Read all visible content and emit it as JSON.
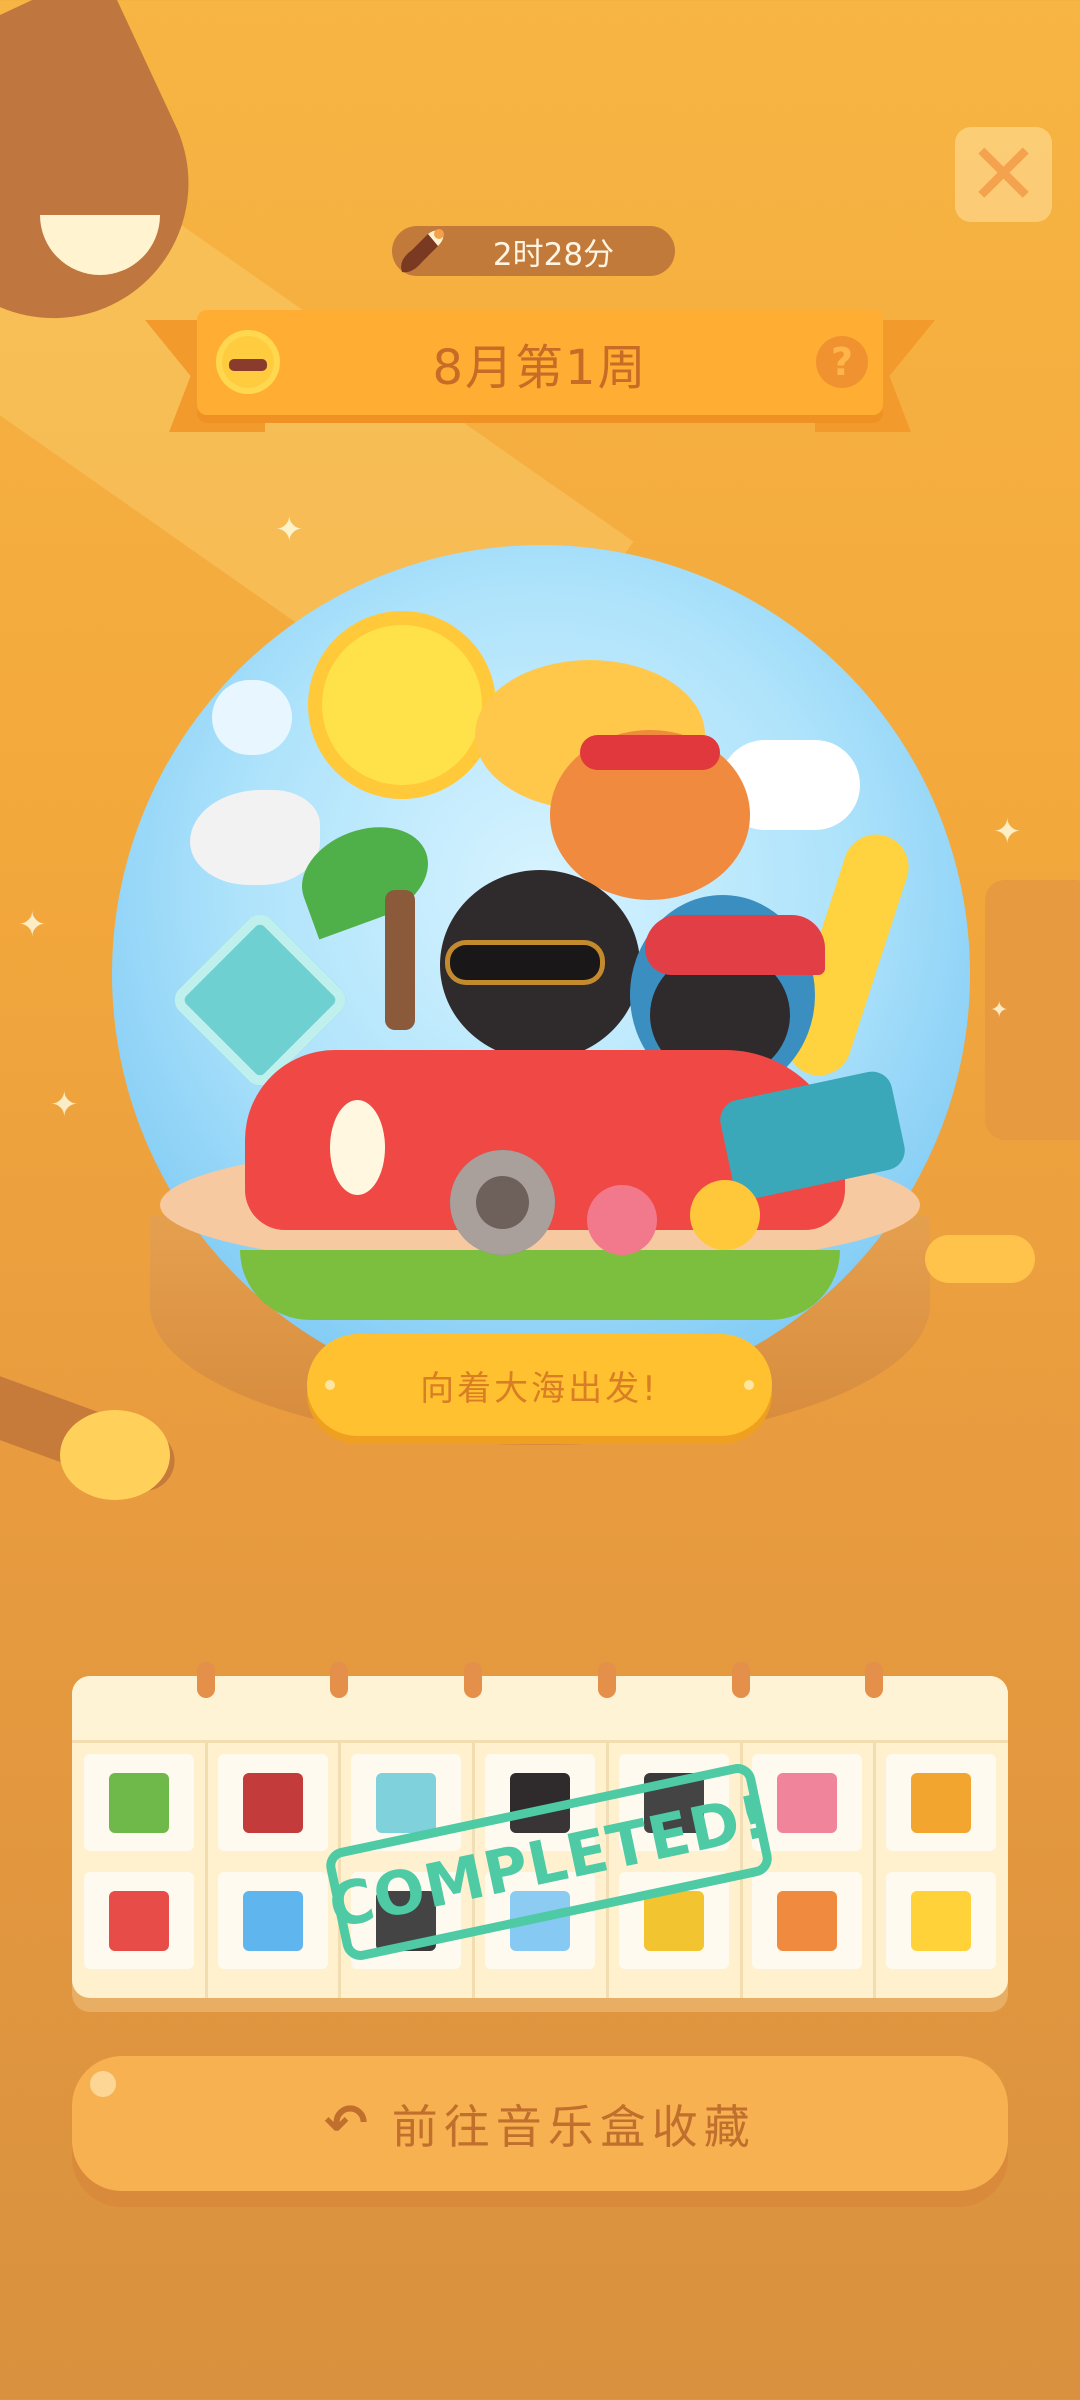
{
  "header": {
    "timer_text": "2时28分",
    "banner_title": "8月第1周",
    "close_icon": "close-icon",
    "help_icon": "help-icon",
    "sun_icon": "sun-sunglasses-icon"
  },
  "globe": {
    "plaque_text": "向着大海出发!"
  },
  "calendar": {
    "completed_stamp": "COMPLETED!",
    "days": [
      {
        "icon": "palm-tree-icon",
        "color": "#6fb84a"
      },
      {
        "icon": "red-car-front-icon",
        "color": "#c33b3a"
      },
      {
        "icon": "road-sign-icon",
        "color": "#7fd1dc"
      },
      {
        "icon": "black-cat-icon",
        "color": "#2f2a2b"
      },
      {
        "icon": "black-cat-sunglasses-icon",
        "color": "#3a3a3a"
      },
      {
        "icon": "flowers-icon",
        "color": "#f0849a"
      },
      {
        "icon": "surfboard-icon",
        "color": "#f2a630"
      },
      {
        "icon": "red-car-icon",
        "color": "#e84c48"
      },
      {
        "icon": "wave-sign-icon",
        "color": "#5fb6ee"
      },
      {
        "icon": "black-cat-hat-icon",
        "color": "#3a3a3a"
      },
      {
        "icon": "white-cat-icon",
        "color": "#86c9f2"
      },
      {
        "icon": "surfboard-yellow-icon",
        "color": "#f2c530"
      },
      {
        "icon": "orange-cat-icon",
        "color": "#f08a3e"
      },
      {
        "icon": "sun-icon",
        "color": "#ffd23a"
      }
    ]
  },
  "footer": {
    "button_label": "前往音乐盒收藏",
    "button_icon": "return-arrow-icon"
  },
  "colors": {
    "background": "#f3a83c",
    "stamp": "#4ecba4",
    "banner": "#ffad33"
  }
}
